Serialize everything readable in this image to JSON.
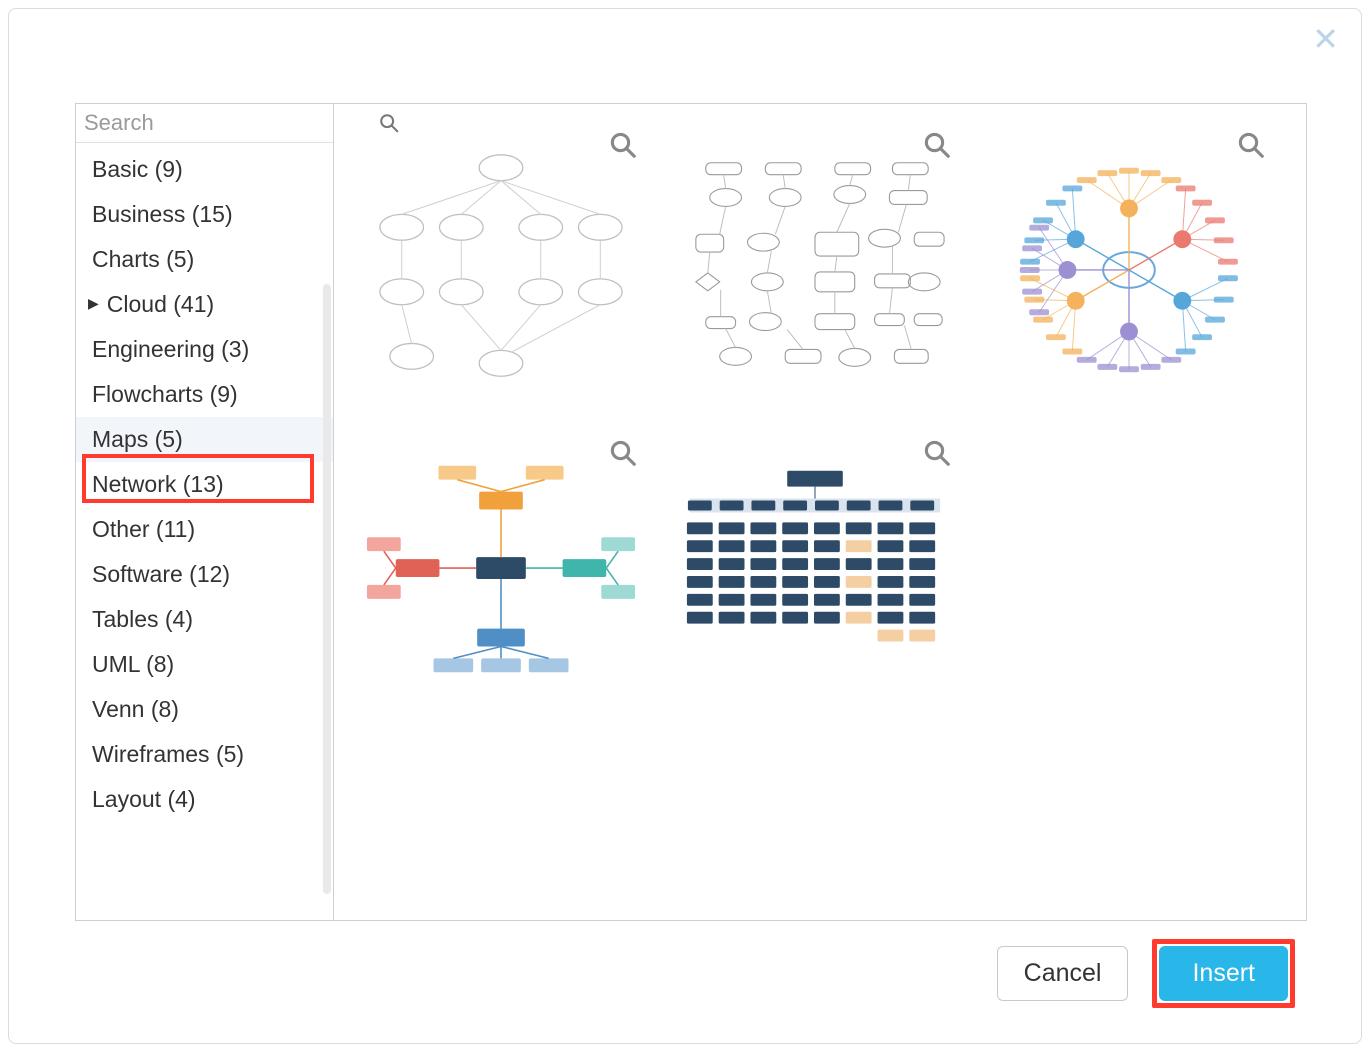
{
  "search": {
    "placeholder": "Search"
  },
  "categories": [
    {
      "label": "Basic (9)",
      "expandable": false,
      "selected": false
    },
    {
      "label": "Business (15)",
      "expandable": false,
      "selected": false
    },
    {
      "label": "Charts (5)",
      "expandable": false,
      "selected": false
    },
    {
      "label": "Cloud (41)",
      "expandable": true,
      "selected": false
    },
    {
      "label": "Engineering (3)",
      "expandable": false,
      "selected": false
    },
    {
      "label": "Flowcharts (9)",
      "expandable": false,
      "selected": false
    },
    {
      "label": "Maps (5)",
      "expandable": false,
      "selected": true
    },
    {
      "label": "Network (13)",
      "expandable": false,
      "selected": false
    },
    {
      "label": "Other (11)",
      "expandable": false,
      "selected": false
    },
    {
      "label": "Software (12)",
      "expandable": false,
      "selected": false
    },
    {
      "label": "Tables (4)",
      "expandable": false,
      "selected": false
    },
    {
      "label": "UML (8)",
      "expandable": false,
      "selected": false
    },
    {
      "label": "Venn (8)",
      "expandable": false,
      "selected": false
    },
    {
      "label": "Wireframes (5)",
      "expandable": false,
      "selected": false
    },
    {
      "label": "Layout (4)",
      "expandable": false,
      "selected": false
    }
  ],
  "footer": {
    "cancel_label": "Cancel",
    "insert_label": "Insert"
  },
  "thumbnails": [
    {
      "kind": "concept-map-mono"
    },
    {
      "kind": "erd-mono"
    },
    {
      "kind": "mindmap-radial-color"
    },
    {
      "kind": "mindmap-rect-color"
    },
    {
      "kind": "sitemap-dark"
    }
  ],
  "highlights": {
    "category_index": 6,
    "primary_button": true
  }
}
